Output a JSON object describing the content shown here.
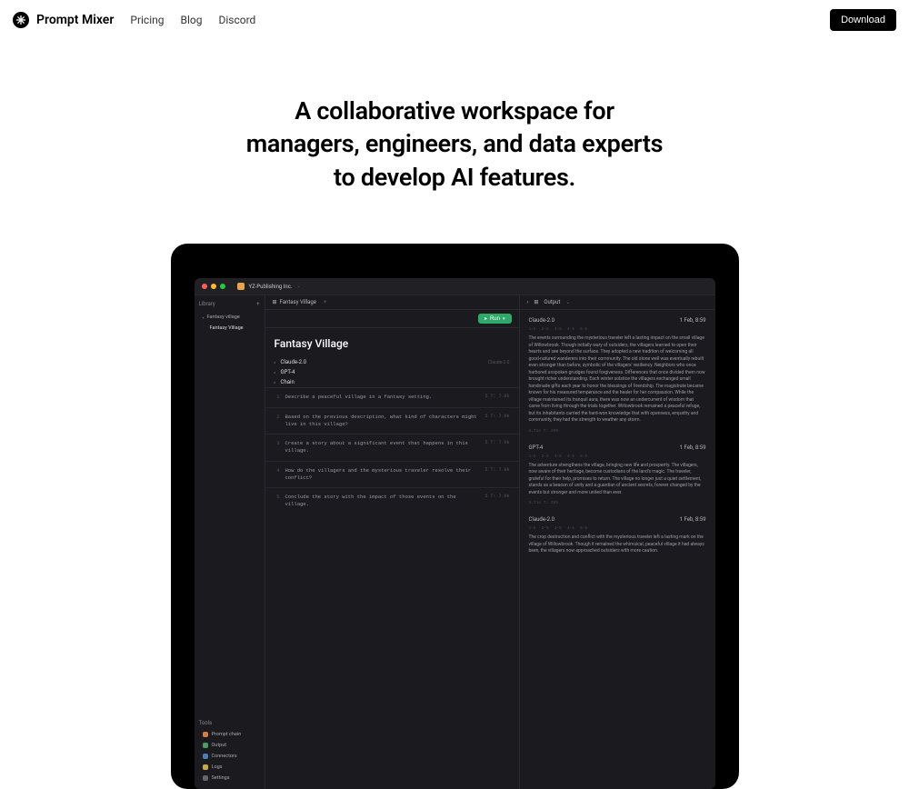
{
  "nav": {
    "brand": "Prompt Mixer",
    "links": {
      "pricing": "Pricing",
      "blog": "Blog",
      "discord": "Discord"
    },
    "download": "Download"
  },
  "hero": {
    "line1": "A collaborative workspace for",
    "line2": "managers, engineers, and data experts",
    "line3": "to develop AI features."
  },
  "app": {
    "workspace_name": "YZ-Publishing Inc.",
    "sidebar": {
      "library_label": "Library",
      "items": [
        {
          "label": "Fantasy village",
          "nested": false
        },
        {
          "label": "Fantasy Village",
          "nested": true
        }
      ],
      "tools_label": "Tools",
      "tools": [
        {
          "label": "Prompt chain",
          "color": "orange"
        },
        {
          "label": "Output",
          "color": "green"
        },
        {
          "label": "Connectors",
          "color": "blue"
        },
        {
          "label": "Logs",
          "color": "yellow"
        },
        {
          "label": "Settings",
          "color": "grey"
        }
      ]
    },
    "main": {
      "tab_label": "Fantasy Village",
      "run_label": "Run",
      "title": "Fantasy Village",
      "models": [
        {
          "name": "Claude-2.0",
          "tag": "Claude-2.0"
        },
        {
          "name": "GPT-4",
          "tag": ""
        },
        {
          "name": "Chain",
          "tag": ""
        }
      ],
      "prompts": [
        "Describe a peaceful village in a fantasy setting.",
        "Based on the previous description, what kind of characters might live in this village?",
        "Create a story about a significant event that happens in this village.",
        "How do the villagers and the mysterious traveler resolve their conflict?",
        "Conclude the story with the impact of those events on the village."
      ],
      "prompt_meta": "5 T: 7.9k"
    },
    "output": {
      "tab_label": "Output",
      "chevron": "‹",
      "cards": [
        {
          "model": "Claude-2.0",
          "time": "1 Feb, 8:59",
          "meta": [
            "1-5",
            "2-5",
            "3-5",
            "4-5",
            "5-5"
          ],
          "text": "The events surrounding the mysterious traveler left a lasting impact on the small village of Willowbrook. Though initially wary of outsiders, the villagers learned to open their hearts and see beyond the surface. They adopted a new tradition of welcoming all good-natured wanderers into their community. The old stone well was eventually rebuilt even stronger than before, symbolic of the villagers' resiliency. Neighbors who once harbored unspoken grudges found forgiveness. Differences that once divided them now brought richer understanding. Each winter solstice the villagers exchanged small handmade gifts each year to honor the blessings of friendship. The magistrate became known for his measured temperance and the healer for her compassion. While the village maintained its tranquil aura, there was now an undercurrent of wisdom that came from living through the trials together. Willowbrook remained a peaceful refuge, but its inhabitants carried the hard-won knowledge that with openness, empathy and community, they had the strength to weather any storm.",
          "footer": "9.71s T: 399"
        },
        {
          "model": "GPT-4",
          "time": "1 Feb, 8:59",
          "meta": [
            "1-5",
            "2-5",
            "3-5",
            "4-5",
            "5-5"
          ],
          "text": "The adventure strengthens the village, bringing new life and prosperity. The villagers, now aware of their heritage, become custodians of the land's magic. The traveler, grateful for their help, promises to return. The village no longer just a quiet settlement, stands as a beacon of unity and a guardian of ancient secrets, forever changed by the events but stronger and more united than ever.",
          "footer": "9.71s T: 399"
        },
        {
          "model": "Claude-2.0",
          "time": "1 Feb, 8:59",
          "meta": [
            "1-5",
            "2-5",
            "3-5",
            "4-5",
            "5-5"
          ],
          "text": "The crop destruction and conflict with the mysterious traveler left a lasting mark on the village of Willowbrook. Though it remained the whimsical, peaceful village it had always been, the villagers now approached outsiders with more caution.",
          "footer": ""
        }
      ]
    }
  }
}
